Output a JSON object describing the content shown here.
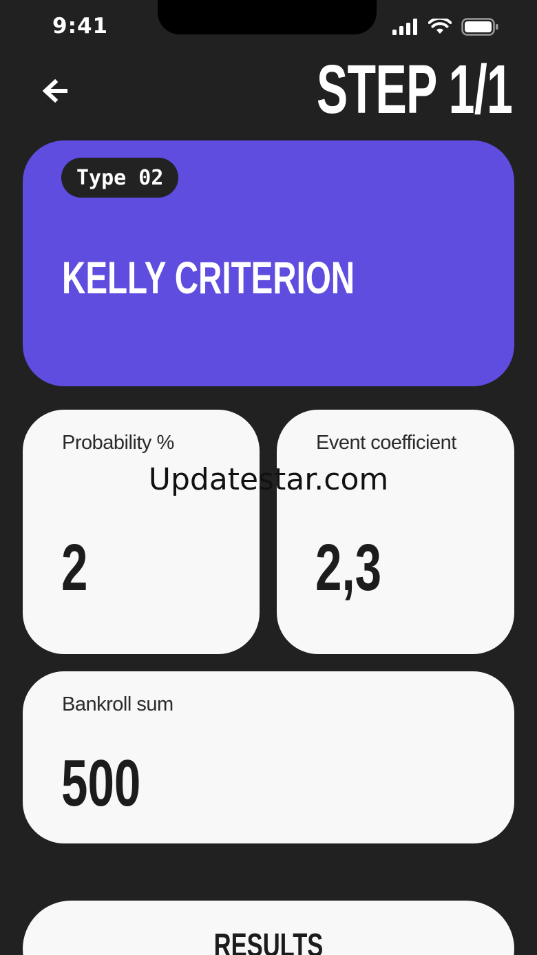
{
  "status_bar": {
    "time": "9:41"
  },
  "header": {
    "step_title": "STEP 1/1"
  },
  "type_card": {
    "badge": "Type 02",
    "title": "KELLY CRITERION",
    "accent_color": "#5e4ddf"
  },
  "inputs": {
    "probability": {
      "label": "Probability %",
      "value": "2"
    },
    "coefficient": {
      "label": "Event coefficient",
      "value": "2,3"
    },
    "bankroll": {
      "label": "Bankroll sum",
      "value": "500"
    }
  },
  "watermark": "Updatestar.com",
  "results_button": {
    "label": "RESULTS"
  },
  "icons": [
    "arrow-left-icon",
    "cellular-signal-icon",
    "wifi-icon",
    "battery-icon"
  ]
}
